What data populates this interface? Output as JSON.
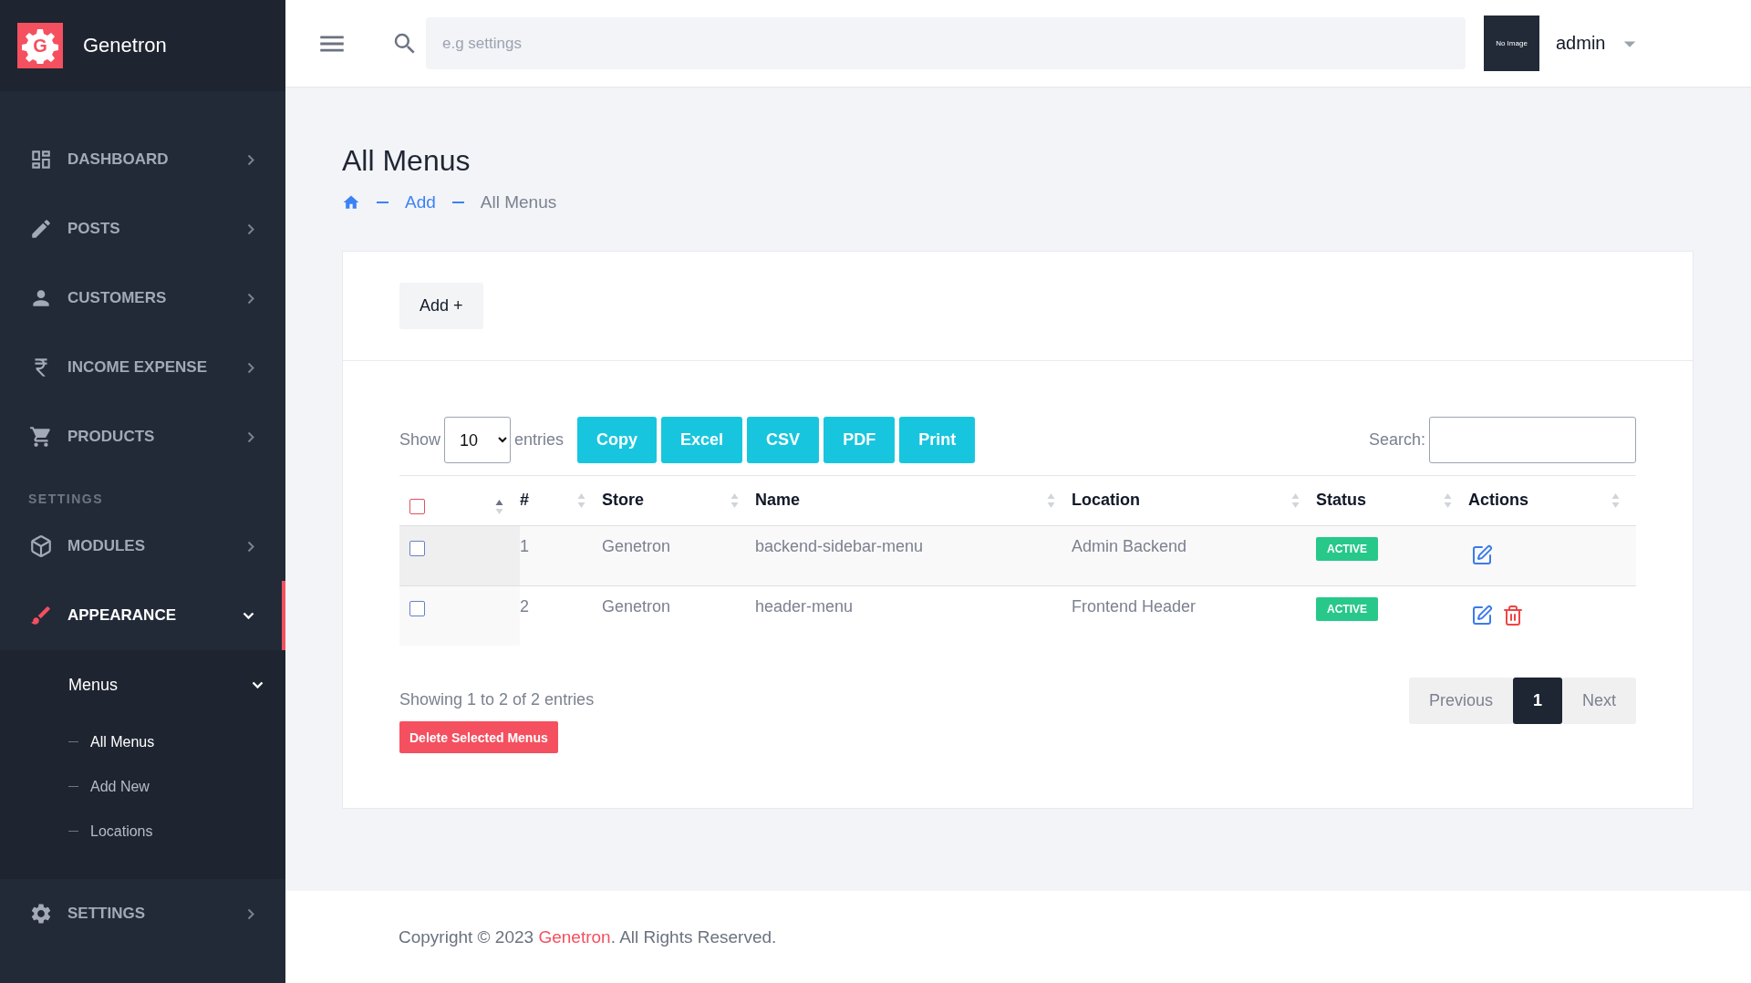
{
  "brand": {
    "logo_letter": "G",
    "name": "Genetron"
  },
  "sidebar": {
    "items": [
      {
        "kind": "nav",
        "label": "DASHBOARD",
        "expanded": false,
        "selected": false
      },
      {
        "kind": "nav",
        "label": "POSTS",
        "expanded": false,
        "selected": false
      },
      {
        "kind": "nav",
        "label": "CUSTOMERS",
        "expanded": false,
        "selected": false
      },
      {
        "kind": "nav",
        "label": "INCOME EXPENSE",
        "expanded": false,
        "selected": false
      },
      {
        "kind": "nav",
        "label": "PRODUCTS",
        "expanded": false,
        "selected": false
      },
      {
        "kind": "section",
        "label": "SETTINGS"
      },
      {
        "kind": "nav",
        "label": "MODULES",
        "expanded": false,
        "selected": false
      },
      {
        "kind": "nav",
        "label": "APPEARANCE",
        "expanded": true,
        "selected": true,
        "children": [
          {
            "label": "Menus",
            "expanded": true,
            "children": [
              {
                "label": "All Menus",
                "selected": true
              },
              {
                "label": "Add New",
                "selected": false
              },
              {
                "label": "Locations",
                "selected": false
              }
            ]
          }
        ]
      },
      {
        "kind": "nav",
        "label": "SETTINGS",
        "expanded": false,
        "selected": false
      }
    ]
  },
  "header": {
    "search": {
      "placeholder": "e.g settings"
    },
    "avatar": {
      "text": "No Image"
    },
    "user": "admin"
  },
  "page": {
    "title": "All Menus",
    "breadcrumb": [
      {
        "label": "Add",
        "current": false
      },
      {
        "label": "All Menus",
        "current": true
      }
    ]
  },
  "card": {
    "add_button": "Add +",
    "length": {
      "before": "Show",
      "value": "10",
      "after": "entries"
    },
    "export_buttons": [
      "Copy",
      "Excel",
      "CSV",
      "PDF",
      "Print"
    ],
    "search_label": "Search:",
    "table": {
      "select_all": {
        "checked": false
      },
      "columns": [
        {
          "sorted": true
        },
        {
          "label": "#",
          "sorted": false
        },
        {
          "label": "Store",
          "sorted": false
        },
        {
          "label": "Name",
          "sorted": false
        },
        {
          "label": "Location",
          "sorted": false
        },
        {
          "label": "Status",
          "sorted": false
        },
        {
          "label": "Actions",
          "sorted": false
        }
      ],
      "rows": [
        {
          "checked": false,
          "number": "1",
          "store": "Genetron",
          "name": "backend-sidebar-menu",
          "location": "Admin Backend",
          "status": "ACTIVE",
          "actions": [
            {
              "kind": "edit"
            }
          ]
        },
        {
          "checked": false,
          "number": "2",
          "store": "Genetron",
          "name": "header-menu",
          "location": "Frontend Header",
          "status": "ACTIVE",
          "actions": [
            {
              "kind": "edit"
            },
            {
              "kind": "delete"
            }
          ]
        }
      ]
    },
    "info": "Showing 1 to 2 of 2 entries",
    "delete_button": "Delete Selected Menus",
    "pagination": {
      "previous": "Previous",
      "pages": [
        {
          "label": "1",
          "selected": true
        }
      ],
      "next": "Next"
    }
  },
  "footer": {
    "prefix": "Copyright © 2023 ",
    "brand": "Genetron",
    "suffix": ". All Rights Reserved."
  }
}
